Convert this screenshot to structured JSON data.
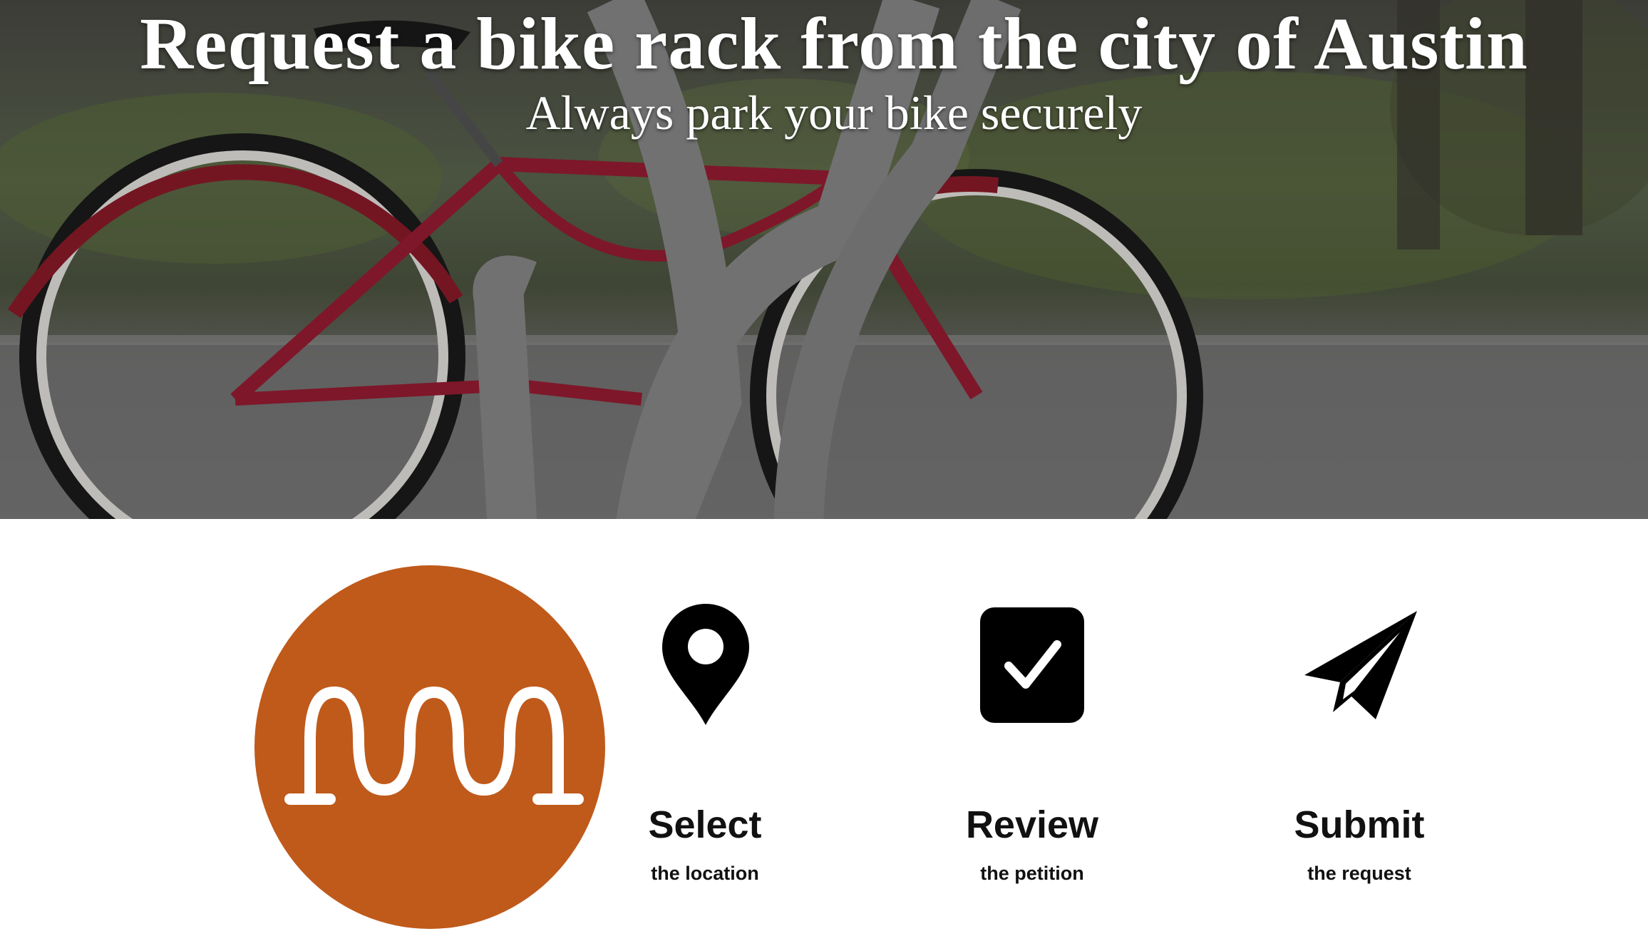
{
  "hero": {
    "title": "Request a bike rack from the city of Austin",
    "subtitle": "Always park your bike securely"
  },
  "brand": {
    "logo_icon": "bike-rack-logo-icon",
    "accent_color": "#bf5a1b"
  },
  "steps": [
    {
      "icon": "map-pin-icon",
      "title": "Select",
      "subtitle": "the location"
    },
    {
      "icon": "checkbox-check-icon",
      "title": "Review",
      "subtitle": "the petition"
    },
    {
      "icon": "paper-plane-icon",
      "title": "Submit",
      "subtitle": "the request"
    }
  ]
}
